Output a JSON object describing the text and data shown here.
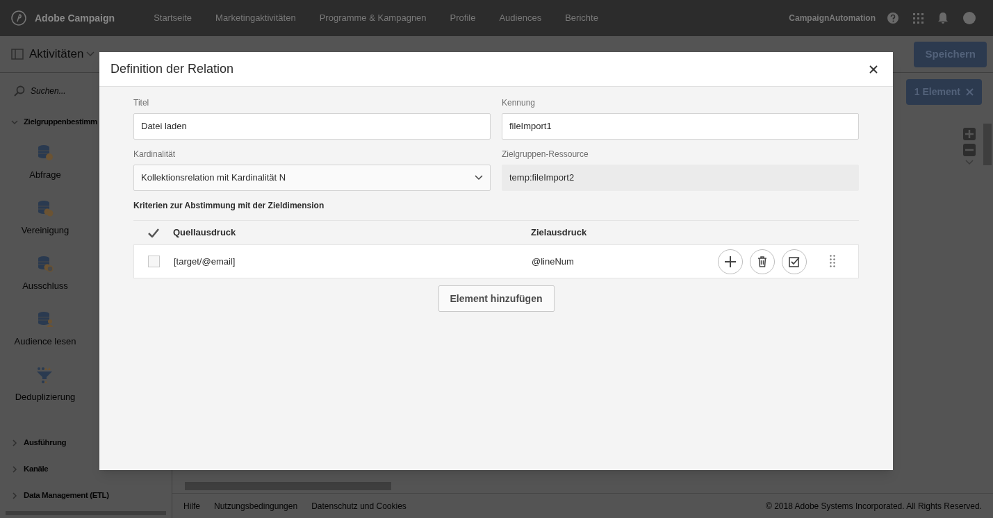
{
  "top_nav": {
    "brand": "Adobe Campaign",
    "items": [
      {
        "label": "Startseite"
      },
      {
        "label": "Marketingaktivitäten"
      },
      {
        "label": "Programme & Kampagnen"
      },
      {
        "label": "Profile"
      },
      {
        "label": "Audiences"
      },
      {
        "label": "Berichte"
      }
    ],
    "user": "CampaignAutomation"
  },
  "toolbar": {
    "title": "Aktivitäten",
    "save_button": "Speichern"
  },
  "sidebar": {
    "search": {
      "placeholder": "Suchen..."
    },
    "sections": [
      {
        "label": "Zielgruppenbestimm",
        "expanded": true,
        "items": [
          {
            "label": "Abfrage",
            "kind": "query"
          },
          {
            "label": "Vereinigung",
            "kind": "union"
          },
          {
            "label": "Ausschluss",
            "kind": "exclusion"
          },
          {
            "label": "Audience lesen",
            "kind": "audience"
          },
          {
            "label": "Deduplizierung",
            "kind": "dedup"
          }
        ]
      },
      {
        "label": "Ausführung",
        "expanded": false
      },
      {
        "label": "Kanäle",
        "expanded": false
      },
      {
        "label": "Data Management (ETL)",
        "expanded": false
      }
    ]
  },
  "canvas": {
    "selection_button": "1 Element"
  },
  "footer": {
    "links": [
      "Hilfe",
      "Nutzungsbedingungen",
      "Datenschutz und Cookies"
    ],
    "copyright": "© 2018 Adobe Systems Incorporated. All Rights Reserved."
  },
  "dialog": {
    "title": "Definition der Relation",
    "fields": [
      {
        "label": "Titel",
        "value": "Datei laden",
        "kind": "text"
      },
      {
        "label": "Kennung",
        "value": "fileImport1",
        "kind": "text"
      },
      {
        "label": "Kardinalität",
        "value": "Kollektionsrelation mit Kardinalität N",
        "kind": "select"
      },
      {
        "label": "Zielgruppen-Ressource",
        "value": "temp:fileImport2",
        "kind": "readonly"
      }
    ],
    "criteria_title": "Kriterien zur Abstimmung mit der Zieldimension",
    "table": {
      "columns": [
        "Quellausdruck",
        "Zielausdruck"
      ],
      "rows": [
        {
          "source": "[target/@email]",
          "target": "@lineNum",
          "checked": false
        }
      ]
    },
    "add_button": "Element hinzufügen"
  }
}
